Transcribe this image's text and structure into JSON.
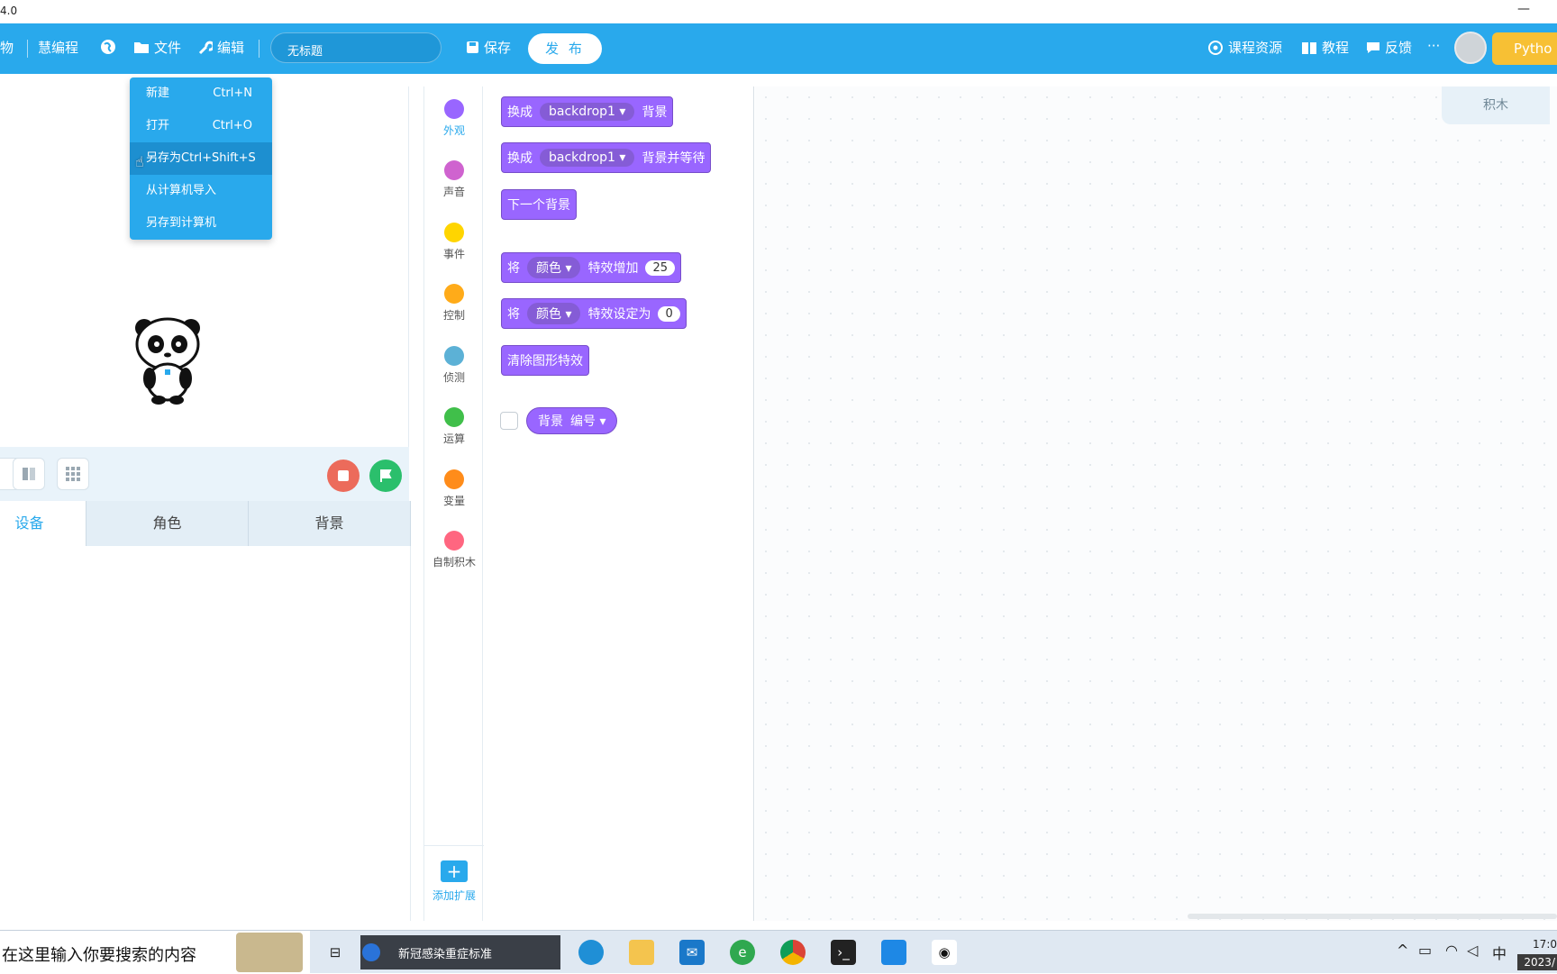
{
  "window": {
    "version_text": "4.0",
    "minimize": "—"
  },
  "topbar": {
    "brand1": "物",
    "brand2": "慧编程",
    "file": "文件",
    "edit": "编辑",
    "title_input": "无标题",
    "save": "保存",
    "publish": "发 布",
    "course": "课程资源",
    "tutorial": "教程",
    "feedback": "反馈",
    "more": "···",
    "python": "Pytho"
  },
  "file_menu": {
    "items": [
      {
        "label": "新建",
        "shortcut": "Ctrl+N"
      },
      {
        "label": "打开",
        "shortcut": "Ctrl+O"
      },
      {
        "label": "另存为Ctrl+Shift+S",
        "shortcut": ""
      },
      {
        "label": "从计算机导入",
        "shortcut": ""
      },
      {
        "label": "另存到计算机",
        "shortcut": ""
      }
    ],
    "highlighted_index": 2
  },
  "tabs": {
    "devices": "设备",
    "sprites": "角色",
    "backdrops": "背景"
  },
  "categories": [
    {
      "label": "外观",
      "color": "#9966ff"
    },
    {
      "label": "声音",
      "color": "#cf63cf"
    },
    {
      "label": "事件",
      "color": "#ffd500"
    },
    {
      "label": "控制",
      "color": "#ffab19"
    },
    {
      "label": "侦测",
      "color": "#5cb1d6"
    },
    {
      "label": "运算",
      "color": "#40bf4a"
    },
    {
      "label": "变量",
      "color": "#ff8c1a"
    },
    {
      "label": "自制积木",
      "color": "#ff6680"
    }
  ],
  "add_extension": "添加扩展",
  "blocks": {
    "b1": {
      "a": "换成",
      "dd": "backdrop1 ▾",
      "b": "背景"
    },
    "b2": {
      "a": "换成",
      "dd": "backdrop1 ▾",
      "b": "背景并等待"
    },
    "b3": {
      "a": "下一个背景"
    },
    "b4": {
      "a": "将",
      "dd": "颜色 ▾",
      "b": "特效增加",
      "num": "25"
    },
    "b5": {
      "a": "将",
      "dd": "颜色 ▾",
      "b": "特效设定为",
      "num": "0"
    },
    "b6": {
      "a": "清除图形特效"
    },
    "reporter": {
      "a": "背景",
      "dd": "编号 ▾"
    }
  },
  "workspace_tab": "积木",
  "taskbar": {
    "search": "在这里输入你要搜索的内容",
    "task_title": "新冠感染重症标准",
    "ime": "中",
    "time": "17:0",
    "date": "2023/"
  }
}
